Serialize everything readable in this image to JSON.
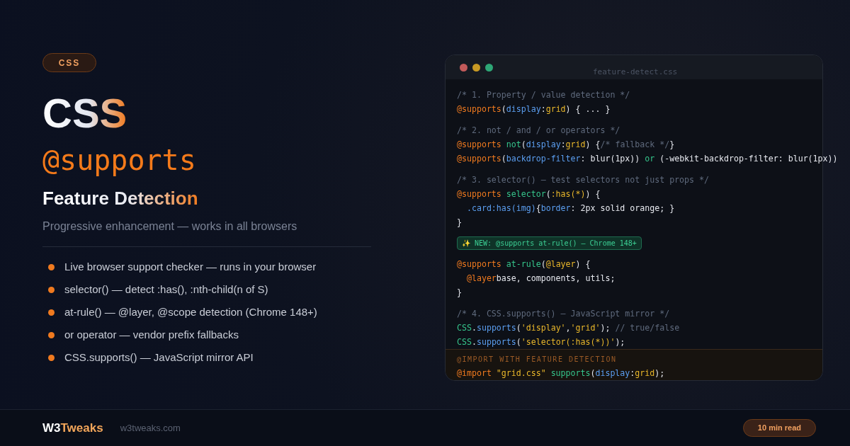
{
  "tag": "CSS",
  "title": "CSS",
  "keyword": "@supports",
  "subtitle": "Feature Detection",
  "tagline": "Progressive enhancement — works in all browsers",
  "features": [
    {
      "text": "Live browser support checker — runs in your browser"
    },
    {
      "text": "selector() — detect :has(), :nth-child(n of S)"
    },
    {
      "text": "at-rule() — @layer, @scope detection (Chrome 148+)"
    },
    {
      "text": "or operator — vendor prefix fallbacks"
    },
    {
      "text": "CSS.supports() — JavaScript mirror API"
    }
  ],
  "editor": {
    "filename": "feature-detect.css",
    "blocks": [
      {
        "kind": "code",
        "lines": [
          [
            {
              "kind": "comment",
              "text": "/* 1. Property / value detection */"
            }
          ],
          [
            {
              "kind": "at",
              "text": "@supports"
            },
            {
              "kind": "plain",
              "text": "("
            },
            {
              "kind": "prop",
              "text": "display"
            },
            {
              "kind": "plain",
              "text": ":"
            },
            {
              "kind": "val",
              "text": "grid"
            },
            {
              "kind": "plain",
              "text": ") { ... }"
            }
          ]
        ]
      },
      {
        "kind": "code",
        "lines": [
          [
            {
              "kind": "comment",
              "text": "/* 2. not / and / or operators */"
            }
          ],
          [
            {
              "kind": "at",
              "text": "@supports "
            },
            {
              "kind": "fn",
              "text": "not"
            },
            {
              "kind": "plain",
              "text": "("
            },
            {
              "kind": "prop",
              "text": "display"
            },
            {
              "kind": "plain",
              "text": ":"
            },
            {
              "kind": "val",
              "text": "grid"
            },
            {
              "kind": "plain",
              "text": ") {"
            },
            {
              "kind": "comment",
              "text": "/* fallback */"
            },
            {
              "kind": "plain",
              "text": "}"
            }
          ],
          [
            {
              "kind": "at",
              "text": "@supports"
            },
            {
              "kind": "plain",
              "text": "("
            },
            {
              "kind": "prop",
              "text": "backdrop-filter"
            },
            {
              "kind": "plain",
              "text": ": blur(1px)) "
            },
            {
              "kind": "fn",
              "text": "or"
            },
            {
              "kind": "plain",
              "text": " (-webkit-backdrop-filter: blur(1px))"
            }
          ]
        ]
      },
      {
        "kind": "code",
        "lines": [
          [
            {
              "kind": "comment",
              "text": "/* 3. selector() — test selectors not just props */"
            }
          ],
          [
            {
              "kind": "at",
              "text": "@supports "
            },
            {
              "kind": "fn",
              "text": "selector"
            },
            {
              "kind": "plain",
              "text": "("
            },
            {
              "kind": "val",
              "text": ":has(*)"
            },
            {
              "kind": "plain",
              "text": ") {"
            }
          ],
          [
            {
              "kind": "prop",
              "text": "  .card:has(img)"
            },
            {
              "kind": "plain",
              "text": "{"
            },
            {
              "kind": "prop",
              "text": "border"
            },
            {
              "kind": "plain",
              "text": ": 2px solid orange; }"
            }
          ],
          [
            {
              "kind": "plain",
              "text": "}"
            }
          ]
        ]
      },
      {
        "kind": "badge",
        "text": "✨ NEW: @supports at-rule() — Chrome 148+"
      },
      {
        "kind": "code",
        "lines": [
          [
            {
              "kind": "at",
              "text": "@supports "
            },
            {
              "kind": "fn",
              "text": "at-rule"
            },
            {
              "kind": "plain",
              "text": "("
            },
            {
              "kind": "val",
              "text": "@layer"
            },
            {
              "kind": "plain",
              "text": ") {"
            }
          ],
          [
            {
              "kind": "at",
              "text": "  @layer"
            },
            {
              "kind": "plain",
              "text": "base, components, utils;"
            }
          ],
          [
            {
              "kind": "plain",
              "text": "}"
            }
          ]
        ]
      },
      {
        "kind": "code",
        "lines": [
          [
            {
              "kind": "comment",
              "text": "/* 4. CSS.supports() — JavaScript mirror */"
            }
          ],
          [
            {
              "kind": "fn",
              "text": "CSS"
            },
            {
              "kind": "plain",
              "text": "."
            },
            {
              "kind": "prop",
              "text": "supports"
            },
            {
              "kind": "plain",
              "text": "("
            },
            {
              "kind": "val",
              "text": "'display'"
            },
            {
              "kind": "plain",
              "text": ","
            },
            {
              "kind": "val",
              "text": "'grid'"
            },
            {
              "kind": "plain",
              "text": "); "
            },
            {
              "kind": "comment",
              "text": "// true/false"
            }
          ],
          [
            {
              "kind": "fn",
              "text": "CSS"
            },
            {
              "kind": "plain",
              "text": "."
            },
            {
              "kind": "prop",
              "text": "supports"
            },
            {
              "kind": "plain",
              "text": "("
            },
            {
              "kind": "val",
              "text": "'selector(:has(*))'"
            },
            {
              "kind": "plain",
              "text": ");"
            }
          ]
        ]
      }
    ],
    "footer": {
      "label": "@IMPORT WITH FEATURE DETECTION",
      "line": [
        {
          "kind": "at",
          "text": "@import "
        },
        {
          "kind": "val",
          "text": "\"grid.css\" "
        },
        {
          "kind": "fn",
          "text": "supports"
        },
        {
          "kind": "plain",
          "text": "("
        },
        {
          "kind": "prop",
          "text": "display"
        },
        {
          "kind": "plain",
          "text": ":"
        },
        {
          "kind": "val",
          "text": "grid"
        },
        {
          "kind": "plain",
          "text": ");"
        }
      ]
    }
  },
  "brand": {
    "prefix": "W3",
    "accent": "Tweaks"
  },
  "site": "w3tweaks.com",
  "read_time": "10 min read"
}
